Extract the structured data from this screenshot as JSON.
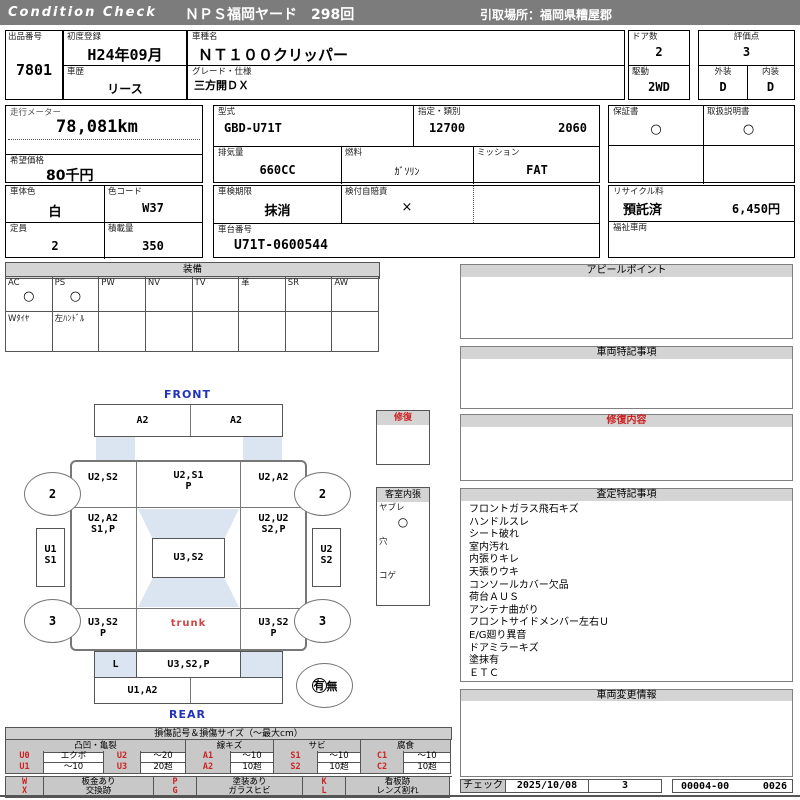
{
  "header": {
    "brand": "Condition  Check",
    "yard": "ＮＰＳ福岡ヤード　298回",
    "pickup": "引取場所：福岡県糟屋郡"
  },
  "info": {
    "lot": {
      "label": "出品番号",
      "value": "7801"
    },
    "first_reg": {
      "label": "初度登録",
      "value": "H24年09月"
    },
    "history": {
      "label": "車歴",
      "value": "リース"
    },
    "model_name": {
      "label": "車種名",
      "value": "ＮＴ１００クリッパー"
    },
    "grade": {
      "label": "グレード・仕様",
      "value": "三方開ＤＸ"
    },
    "doors": {
      "label": "ドア数",
      "value": "2"
    },
    "drive": {
      "label": "駆動",
      "value": "2WD"
    },
    "score": {
      "label": "評価点",
      "value": "3"
    },
    "exterior": {
      "label": "外装",
      "value": "D"
    },
    "interior": {
      "label": "内装",
      "value": "D"
    },
    "odometer": {
      "label": "走行メーター",
      "value": "78,081km"
    },
    "price": {
      "label": "希望価格",
      "value": "80千円"
    },
    "model_code": {
      "label": "型式",
      "value": "GBD-U71T"
    },
    "type_class": {
      "label": "指定・類別",
      "value1": "12700",
      "value2": "2060"
    },
    "displacement": {
      "label": "排気量",
      "value": "660CC"
    },
    "fuel": {
      "label": "燃料",
      "value": "ｶﾞｿﾘﾝ"
    },
    "mission": {
      "label": "ミッション",
      "value": "FAT"
    },
    "warranty": {
      "label": "保証書",
      "value": "○"
    },
    "manual": {
      "label": "取扱説明書",
      "value": "○"
    },
    "body_color": {
      "label": "車体色",
      "value": "白"
    },
    "color_code": {
      "label": "色コード",
      "value": "W37"
    },
    "inspection": {
      "label": "車検期限",
      "value": "抹消"
    },
    "insurance": {
      "label": "検付自賠責",
      "value": "×"
    },
    "capacity": {
      "label": "定員",
      "value": "2"
    },
    "load": {
      "label": "積載量",
      "value": "350"
    },
    "chassis": {
      "label": "車台番号",
      "value": "U71T-0600544"
    },
    "recycle": {
      "label": "リサイクル料",
      "status": "預託済",
      "fee": "6,450円"
    },
    "welfare": {
      "label": "福祉車両",
      "value": ""
    }
  },
  "equipment": {
    "title": "装備",
    "cols": [
      {
        "label": "AC",
        "mark": "○"
      },
      {
        "label": "PS",
        "mark": "○"
      },
      {
        "label": "PW",
        "mark": ""
      },
      {
        "label": "NV",
        "mark": ""
      },
      {
        "label": "TV",
        "mark": ""
      },
      {
        "label": "革",
        "mark": ""
      },
      {
        "label": "SR",
        "mark": ""
      },
      {
        "label": "AW",
        "mark": ""
      }
    ],
    "row2": [
      "Wﾀｲﾔ",
      "左ﾊﾝﾄﾞﾙ",
      "",
      "",
      "",
      "",
      "",
      ""
    ]
  },
  "diagram": {
    "front": "FRONT",
    "rear": "REAR",
    "trunk": "trunk",
    "bonnet_left": "A2",
    "bonnet_right": "A2",
    "row1_left": "U2,S2",
    "row1_mid": "U2,S1\nP",
    "row1_right": "U2,A2",
    "row2_left": "U2,A2\nS1,P",
    "row2_right": "U2,U2\nS2,P",
    "roof": "U3,S2",
    "row3_left": "U3,S2\nP",
    "row3_right": "U3,S2\nP",
    "lower_l": "L",
    "lower_mid": "U3,S2,P",
    "bottom": "U1,A2",
    "side_left": "U1\nS1",
    "side_right": "U2\nS2",
    "wheel_fl": "2",
    "wheel_fr": "2",
    "wheel_rl": "3",
    "wheel_rr": "3",
    "presence_yes": "有",
    "presence_no": "無",
    "repair_box_title": "修復",
    "cabin_title": "客室内張",
    "cabin_rows": [
      {
        "label": "ヤブレ",
        "mark": "○"
      },
      {
        "label": "穴",
        "mark": ""
      },
      {
        "label": "コゲ",
        "mark": ""
      }
    ]
  },
  "panels": {
    "appeal": {
      "title": "アピールポイント",
      "content": ""
    },
    "notes": {
      "title": "車両特記事項",
      "content": ""
    },
    "repair": {
      "title": "修復内容",
      "content": ""
    },
    "assessment": {
      "title": "査定特記事項",
      "items": [
        "フロントガラス飛石キズ",
        "ハンドルスレ",
        "シート破れ",
        "室内汚れ",
        "内張りキレ",
        "天張りウキ",
        "コンソールカバー欠品",
        "荷台ＡＵＳ",
        "アンテナ曲がり",
        "フロントサイドメンバー左右Ｕ",
        "E/G廻り異音",
        "ドアミラーキズ",
        "塗抹有",
        "ＥＴＣ"
      ]
    },
    "change": {
      "title": "車両変更情報",
      "content": ""
    }
  },
  "check": {
    "label": "チェック",
    "date": "2025/10/08",
    "value": "3",
    "code": "00004-00",
    "code2": "0026"
  },
  "legend": {
    "title": "損傷記号＆損傷サイズ（～最大cm）",
    "groups": [
      "凸凹・亀裂",
      "線キズ",
      "サビ",
      "腐食"
    ],
    "row1": [
      "U0",
      "エクボ",
      "U2",
      "～20",
      "A1",
      "～10",
      "S1",
      "～10",
      "C1",
      "～10"
    ],
    "row2": [
      "U1",
      "～10",
      "U3",
      "20超",
      "A2",
      "10超",
      "S2",
      "10超",
      "C2",
      "10超"
    ],
    "row3": [
      "W",
      "板金あり",
      "P",
      "塗装あり",
      "K",
      "看板跡"
    ],
    "row4": [
      "X",
      "交換跡",
      "G",
      "ガラスヒビ",
      "L",
      "レンズ割れ"
    ]
  },
  "colors": {
    "accent_red": "#cc2222",
    "label_blue": "#2233bb",
    "shade_blue": "#dbe5f1",
    "header_gray": "#7c7c7c"
  }
}
